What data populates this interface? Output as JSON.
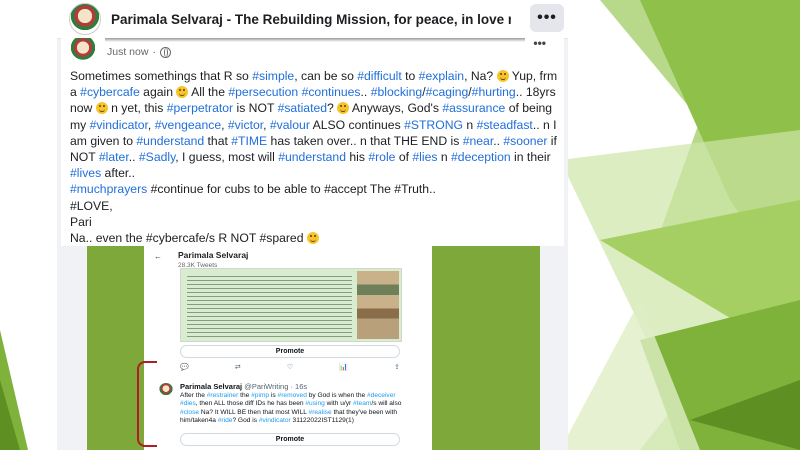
{
  "header": {
    "title": "Parimala Selvaraj - The Rebuilding Mission, for peace, in love n tr...",
    "more_label": "•••"
  },
  "post": {
    "timestamp": "Just now",
    "more_label": "•••",
    "paragraphs": [
      [
        {
          "t": "Sometimes somethings that R so "
        },
        {
          "t": "#simple",
          "tag": true
        },
        {
          "t": ", can be so "
        },
        {
          "t": "#difficult",
          "tag": true
        },
        {
          "t": " to "
        },
        {
          "t": "#explain",
          "tag": true
        },
        {
          "t": ", Na? "
        },
        {
          "e": true
        },
        {
          "t": " Yup, frm a "
        },
        {
          "t": "#cybercafe",
          "tag": true
        },
        {
          "t": " again "
        },
        {
          "e": true
        },
        {
          "t": " All the "
        },
        {
          "t": "#persecution",
          "tag": true
        },
        {
          "t": " "
        },
        {
          "t": "#continues",
          "tag": true
        },
        {
          "t": ".. "
        },
        {
          "t": "#blocking",
          "tag": true
        },
        {
          "t": "/"
        },
        {
          "t": "#caging",
          "tag": true
        },
        {
          "t": "/"
        },
        {
          "t": "#hurting",
          "tag": true
        },
        {
          "t": ".. 18yrs now "
        },
        {
          "e": true
        },
        {
          "t": " n yet, this "
        },
        {
          "t": "#perpetrator",
          "tag": true
        },
        {
          "t": " is NOT "
        },
        {
          "t": "#satiated",
          "tag": true
        },
        {
          "t": "? "
        },
        {
          "e": true
        },
        {
          "t": " Anyways, God's "
        },
        {
          "t": "#assurance",
          "tag": true
        },
        {
          "t": " of being my "
        },
        {
          "t": "#vindicator",
          "tag": true
        },
        {
          "t": ", "
        },
        {
          "t": "#vengeance",
          "tag": true
        },
        {
          "t": ", "
        },
        {
          "t": "#victor",
          "tag": true
        },
        {
          "t": ", "
        },
        {
          "t": "#valour",
          "tag": true
        },
        {
          "t": " ALSO continues "
        },
        {
          "t": "#STRONG",
          "tag": true
        },
        {
          "t": " n "
        },
        {
          "t": "#steadfast",
          "tag": true
        },
        {
          "t": ".. n I am given to "
        },
        {
          "t": "#understand",
          "tag": true
        },
        {
          "t": " that "
        },
        {
          "t": "#TIME",
          "tag": true
        },
        {
          "t": " has taken over.. n that THE END is "
        },
        {
          "t": "#near",
          "tag": true
        },
        {
          "t": ".. "
        },
        {
          "t": "#sooner",
          "tag": true
        },
        {
          "t": " if NOT "
        },
        {
          "t": "#later",
          "tag": true
        },
        {
          "t": ".. "
        },
        {
          "t": "#Sadly",
          "tag": true
        },
        {
          "t": ", I guess, most will "
        },
        {
          "t": "#understand",
          "tag": true
        },
        {
          "t": " his "
        },
        {
          "t": "#role",
          "tag": true
        },
        {
          "t": " of "
        },
        {
          "t": "#lies",
          "tag": true
        },
        {
          "t": " n "
        },
        {
          "t": "#deception",
          "tag": true
        },
        {
          "t": " in their "
        },
        {
          "t": "#lives",
          "tag": true
        },
        {
          "t": " after.."
        }
      ],
      [
        {
          "t": "#muchprayers",
          "tag": true
        },
        {
          "t": " #continue for cubs to be able to #accept The #Truth.."
        }
      ],
      [
        {
          "t": "#LOVE,"
        }
      ],
      [
        {
          "t": "Pari"
        }
      ],
      [
        {
          "t": "Na.. even the #cybercafe/s R NOT #spared "
        },
        {
          "e": true
        }
      ]
    ]
  },
  "embedded_tweet": {
    "profile_name": "Parimala Selvaraj",
    "tweet_count": "28.3K Tweets",
    "promote_label": "Promote",
    "promote_label_2": "Promote",
    "actions": [
      "💬",
      "⇄",
      "♡",
      "📊",
      "⇪"
    ],
    "reply_author": "Parimala Selvaraj",
    "reply_handle": "@PariWriting · 16s",
    "reply_text": [
      {
        "t": "After the "
      },
      {
        "t": "#restrainer",
        "tag": true
      },
      {
        "t": " the "
      },
      {
        "t": "#pimp",
        "tag": true
      },
      {
        "t": " is "
      },
      {
        "t": "#removed",
        "tag": true
      },
      {
        "t": " by God is when the "
      },
      {
        "t": "#deceiver",
        "tag": true
      },
      {
        "t": " "
      },
      {
        "t": "#dies",
        "tag": true
      },
      {
        "t": ", then ALL those diff IDs he has been "
      },
      {
        "t": "#using",
        "tag": true
      },
      {
        "t": " with u/yr "
      },
      {
        "t": "#team",
        "tag": true
      },
      {
        "t": "/s will also "
      },
      {
        "t": "#close",
        "tag": true
      },
      {
        "t": " Na? It WILL BE then that most WILL "
      },
      {
        "t": "#realise",
        "tag": true
      },
      {
        "t": " that they've been with him/taken4a "
      },
      {
        "t": "#ride",
        "tag": true
      },
      {
        "t": "? God is "
      },
      {
        "t": "#vindicator",
        "tag": true
      },
      {
        "t": " 31122022IST1129(1)"
      }
    ]
  }
}
